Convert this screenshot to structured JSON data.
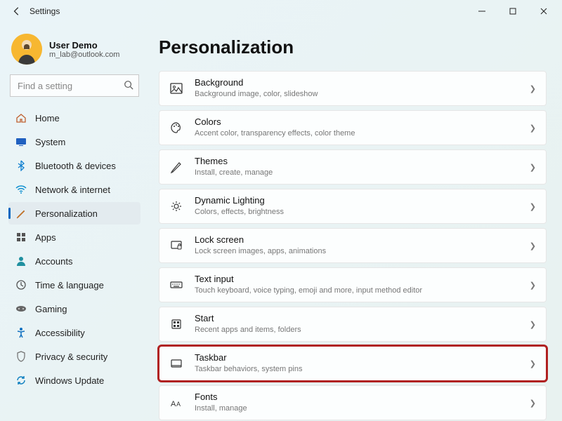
{
  "titlebar": {
    "title": "Settings"
  },
  "user": {
    "name": "User Demo",
    "email": "m_lab@outlook.com"
  },
  "search": {
    "placeholder": "Find a setting"
  },
  "nav": {
    "items": [
      {
        "label": "Home"
      },
      {
        "label": "System"
      },
      {
        "label": "Bluetooth & devices"
      },
      {
        "label": "Network & internet"
      },
      {
        "label": "Personalization"
      },
      {
        "label": "Apps"
      },
      {
        "label": "Accounts"
      },
      {
        "label": "Time & language"
      },
      {
        "label": "Gaming"
      },
      {
        "label": "Accessibility"
      },
      {
        "label": "Privacy & security"
      },
      {
        "label": "Windows Update"
      }
    ]
  },
  "page": {
    "title": "Personalization"
  },
  "cards": [
    {
      "title": "Background",
      "sub": "Background image, color, slideshow"
    },
    {
      "title": "Colors",
      "sub": "Accent color, transparency effects, color theme"
    },
    {
      "title": "Themes",
      "sub": "Install, create, manage"
    },
    {
      "title": "Dynamic Lighting",
      "sub": "Colors, effects, brightness"
    },
    {
      "title": "Lock screen",
      "sub": "Lock screen images, apps, animations"
    },
    {
      "title": "Text input",
      "sub": "Touch keyboard, voice typing, emoji and more, input method editor"
    },
    {
      "title": "Start",
      "sub": "Recent apps and items, folders"
    },
    {
      "title": "Taskbar",
      "sub": "Taskbar behaviors, system pins"
    },
    {
      "title": "Fonts",
      "sub": "Install, manage"
    }
  ]
}
